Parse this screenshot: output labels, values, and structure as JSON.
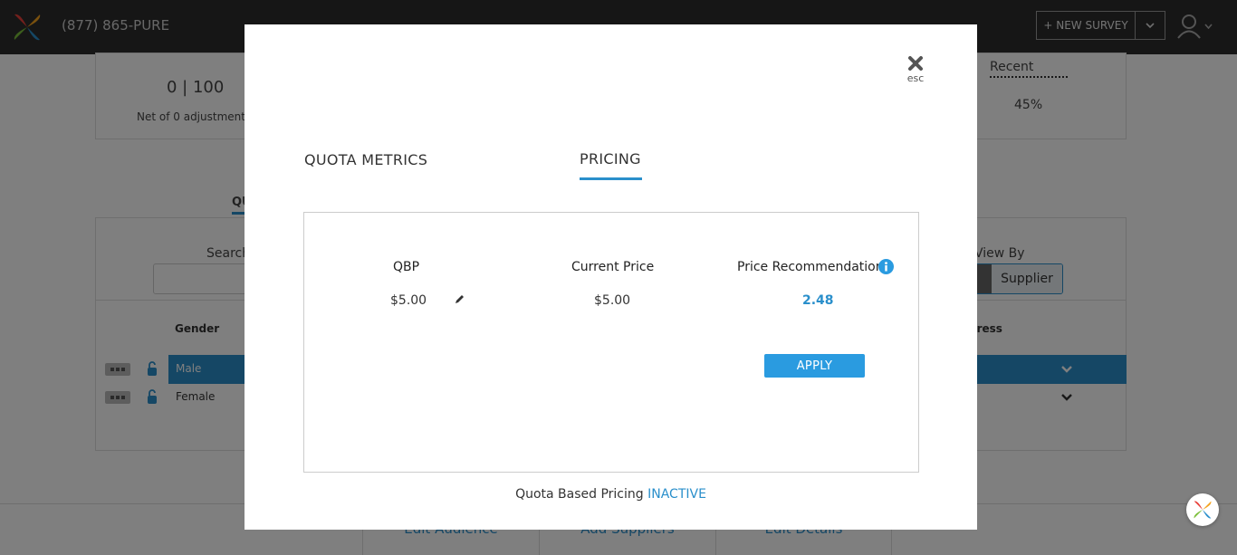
{
  "header": {
    "phone": "(877) 865-PURE",
    "new_survey_label": "+ NEW SURVEY"
  },
  "stats": {
    "count": "0 | 100",
    "net_adjustments": "Net of 0 adjustment",
    "recent_label": "Recent",
    "recent_value": "45%"
  },
  "background_tab": "QU",
  "quota_panel": {
    "search_label": "Search",
    "view_by_label": "View By",
    "view_by_option": "Supplier",
    "columns": {
      "gender": "Gender",
      "progress": "gress"
    },
    "rows": [
      {
        "label": "Male"
      },
      {
        "label": "Female"
      }
    ]
  },
  "bottom_actions": [
    "Edit Audience",
    "Add Suppliers",
    "Edit Details"
  ],
  "modal": {
    "close_label": "esc",
    "tabs": [
      {
        "label": "QUOTA METRICS",
        "active": false
      },
      {
        "label": "PRICING",
        "active": true
      }
    ],
    "pricing": {
      "qbp_header": "QBP",
      "current_price_header": "Current Price",
      "recommendation_header": "Price Recommendation",
      "qbp_value": "$5.00",
      "current_price_value": "$5.00",
      "recommendation_value": "2.48",
      "apply_label": "APPLY"
    },
    "status_prefix": "Quota Based Pricing",
    "status_value": "INACTIVE"
  },
  "colors": {
    "accent": "#2a8fcb",
    "apply_button": "#2a9be0",
    "topbar": "#2d2d2d"
  }
}
